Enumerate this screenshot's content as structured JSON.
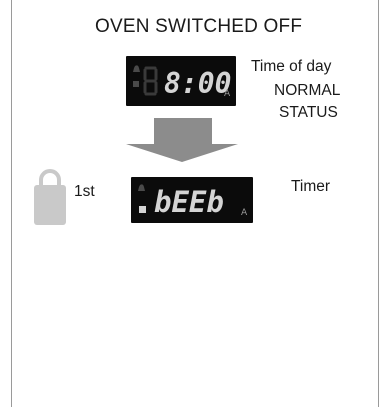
{
  "title": "OVEN SWITCHED OFF",
  "normal_display": {
    "digits": "8:00",
    "suffix": "A",
    "label_lines": [
      "Time of day",
      "NORMAL",
      "STATUS"
    ]
  },
  "timer_display": {
    "digits": "bEEb",
    "suffix": "A",
    "label": "Timer"
  },
  "press": {
    "label": "1st",
    "icon": "lock-icon"
  },
  "colors": {
    "segment": "#d4d4d4",
    "segment_dim": "#3a3a3a",
    "display_bg": "#0b0b0b",
    "arrow": "#8c8c8c",
    "lock": "#c9c9c9"
  }
}
